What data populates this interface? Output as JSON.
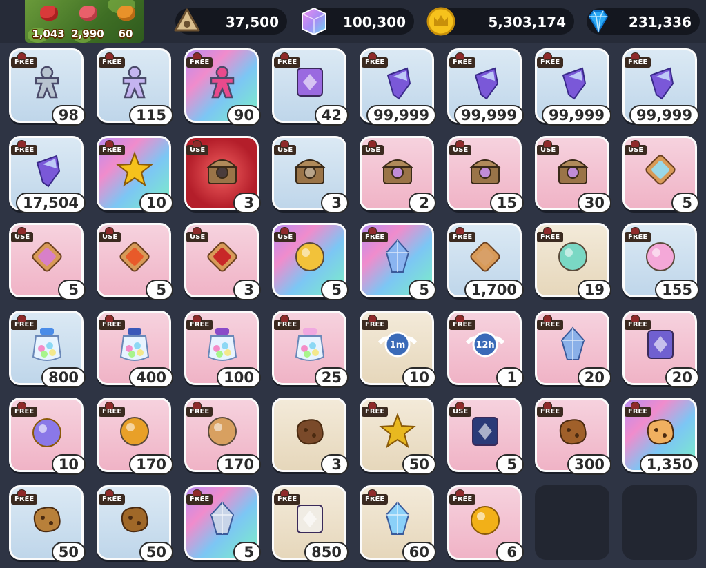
{
  "stamina": {
    "meat_count": "1,043",
    "ham_count": "2,990",
    "drumstick_count": "60"
  },
  "currencies": [
    {
      "name": "coin-token",
      "value": "37,500",
      "icon": "triangle-coin-icon",
      "color": "#c8a878"
    },
    {
      "name": "rainbow-cube",
      "value": "100,300",
      "icon": "rainbow-cube-icon",
      "color": "#c58cf2"
    },
    {
      "name": "gold-coin",
      "value": "5,303,174",
      "icon": "crown-coin-icon",
      "color": "#f2b81c"
    },
    {
      "name": "crystal",
      "value": "231,336",
      "icon": "diamond-icon",
      "color": "#28a8f2"
    }
  ],
  "inventory": [
    {
      "tag": "FREE",
      "count": "98",
      "bg": "blue",
      "icon": "gingerbread-cutter-silver-icon",
      "color": "#b8c4d0"
    },
    {
      "tag": "FREE",
      "count": "115",
      "bg": "blue",
      "icon": "gingerbread-cutter-purple-icon",
      "color": "#c4b4f0"
    },
    {
      "tag": "FREE",
      "count": "90",
      "bg": "rainbow",
      "icon": "gingerbread-cutter-pink-icon",
      "color": "#e84a8c"
    },
    {
      "tag": "FREE",
      "count": "42",
      "bg": "blue",
      "icon": "purple-gem-ticket-icon",
      "color": "#9a6ae0"
    },
    {
      "tag": "FREE",
      "count": "99,999",
      "bg": "blue",
      "icon": "crystal-shard-icon",
      "color": "#7a58d8"
    },
    {
      "tag": "FREE",
      "count": "99,999",
      "bg": "blue",
      "icon": "crystal-shard-icon",
      "color": "#7a58d8"
    },
    {
      "tag": "FREE",
      "count": "99,999",
      "bg": "blue",
      "icon": "crystal-shard-icon",
      "color": "#7a58d8"
    },
    {
      "tag": "FREE",
      "count": "99,999",
      "bg": "blue",
      "icon": "crystal-shard-icon",
      "color": "#7a58d8"
    },
    {
      "tag": "FREE",
      "count": "17,504",
      "bg": "blue",
      "icon": "crystal-shard-icon",
      "color": "#7a58d8"
    },
    {
      "tag": "FREE",
      "count": "10",
      "bg": "rainbow",
      "icon": "gold-star-icon",
      "color": "#f6c21c"
    },
    {
      "tag": "USE",
      "count": "3",
      "bg": "red",
      "icon": "dark-treasure-chest-icon",
      "color": "#4a3c3c"
    },
    {
      "tag": "USE",
      "count": "3",
      "bg": "blue",
      "icon": "silver-treasure-chest-icon",
      "color": "#b8a48a"
    },
    {
      "tag": "USE",
      "count": "2",
      "bg": "pink",
      "icon": "potion-treasure-chest-icon",
      "color": "#c08cd8"
    },
    {
      "tag": "USE",
      "count": "15",
      "bg": "pink",
      "icon": "potion-treasure-chest-icon",
      "color": "#c08cd8"
    },
    {
      "tag": "USE",
      "count": "30",
      "bg": "pink",
      "icon": "potion-treasure-chest-icon",
      "color": "#c08cd8"
    },
    {
      "tag": "USE",
      "count": "5",
      "bg": "pink",
      "icon": "rainbow-tile-icon",
      "color": "#9ad8e8"
    },
    {
      "tag": "USE",
      "count": "5",
      "bg": "pink",
      "icon": "pink-magic-tile-icon",
      "color": "#d880c8"
    },
    {
      "tag": "USE",
      "count": "5",
      "bg": "pink",
      "icon": "orange-magic-tile-icon",
      "color": "#e85a2a"
    },
    {
      "tag": "USE",
      "count": "3",
      "bg": "pink",
      "icon": "strawberry-tile-icon",
      "color": "#c82828"
    },
    {
      "tag": "USE",
      "count": "5",
      "bg": "rainbow",
      "icon": "golden-winged-crest-icon",
      "color": "#f2c23a"
    },
    {
      "tag": "FREE",
      "count": "5",
      "bg": "rainbow",
      "icon": "prism-crystal-icon",
      "color": "#8ab4f0"
    },
    {
      "tag": "FREE",
      "count": "1,700",
      "bg": "blue",
      "icon": "cookie-star-tile-icon",
      "color": "#d8a068"
    },
    {
      "tag": "FREE",
      "count": "19",
      "bg": "cream",
      "icon": "mint-cloud-icon",
      "color": "#7ad8c4"
    },
    {
      "tag": "FREE",
      "count": "155",
      "bg": "blue",
      "icon": "pastel-candy-icon",
      "color": "#f4a8d8"
    },
    {
      "tag": "FREE",
      "count": "800",
      "bg": "blue",
      "icon": "gumball-jar-blue-icon",
      "color": "#4a8ce8"
    },
    {
      "tag": "FREE",
      "count": "400",
      "bg": "pink",
      "icon": "gumball-jar-navy-icon",
      "color": "#3a58b8"
    },
    {
      "tag": "FREE",
      "count": "100",
      "bg": "pink",
      "icon": "gumball-jar-purple-icon",
      "color": "#8a4ac8"
    },
    {
      "tag": "FREE",
      "count": "25",
      "bg": "pink",
      "icon": "winged-gumball-jar-icon",
      "color": "#f0a8e0"
    },
    {
      "tag": "FREE",
      "count": "10",
      "bg": "cream",
      "icon": "time-jumper-1m-icon",
      "color": "#3a6ab8",
      "label": "1m"
    },
    {
      "tag": "FREE",
      "count": "1",
      "bg": "pink",
      "icon": "time-jumper-12h-icon",
      "color": "#3a6ab8",
      "label": "12h"
    },
    {
      "tag": "FREE",
      "count": "20",
      "bg": "pink",
      "icon": "crystal-pillar-icon",
      "color": "#8ab0e8"
    },
    {
      "tag": "FREE",
      "count": "20",
      "bg": "pink",
      "icon": "purple-stone-box-icon",
      "color": "#7060d0"
    },
    {
      "tag": "FREE",
      "count": "10",
      "bg": "pink",
      "icon": "crystal-ring-icon",
      "color": "#8a78e8"
    },
    {
      "tag": "FREE",
      "count": "170",
      "bg": "pink",
      "icon": "golden-spyglass-icon",
      "color": "#e8a028"
    },
    {
      "tag": "FREE",
      "count": "170",
      "bg": "pink",
      "icon": "treasure-map-icon",
      "color": "#d8a060"
    },
    {
      "tag": "",
      "count": "3",
      "bg": "cream",
      "icon": "chocolate-log-icon",
      "color": "#7a4a2a"
    },
    {
      "tag": "FREE",
      "count": "50",
      "bg": "cream",
      "icon": "golden-star-shard-icon",
      "color": "#e8b820"
    },
    {
      "tag": "USE",
      "count": "5",
      "bg": "pink",
      "icon": "magic-card-icon",
      "color": "#2a3a78"
    },
    {
      "tag": "FREE",
      "count": "300",
      "bg": "pink",
      "icon": "chocolate-chip-chunk-icon",
      "color": "#a0602a"
    },
    {
      "tag": "FREE",
      "count": "1,350",
      "bg": "rainbow",
      "icon": "berry-cake-chunk-icon",
      "color": "#f0b060"
    },
    {
      "tag": "FREE",
      "count": "50",
      "bg": "blue",
      "icon": "cookie-crumb-icon",
      "color": "#b8803a"
    },
    {
      "tag": "FREE",
      "count": "50",
      "bg": "blue",
      "icon": "cookie-crumbs-icon",
      "color": "#a06828"
    },
    {
      "tag": "FREE",
      "count": "5",
      "bg": "rainbow",
      "icon": "crystal-scoops-icon",
      "color": "#c8d4e8"
    },
    {
      "tag": "FREE",
      "count": "850",
      "bg": "cream",
      "icon": "sugar-cube-icon",
      "color": "#f0ece4"
    },
    {
      "tag": "FREE",
      "count": "60",
      "bg": "cream",
      "icon": "blue-crystal-cluster-icon",
      "color": "#8ad0f8"
    },
    {
      "tag": "FREE",
      "count": "6",
      "bg": "pink",
      "icon": "golden-orb-icon",
      "color": "#f2b018"
    }
  ]
}
